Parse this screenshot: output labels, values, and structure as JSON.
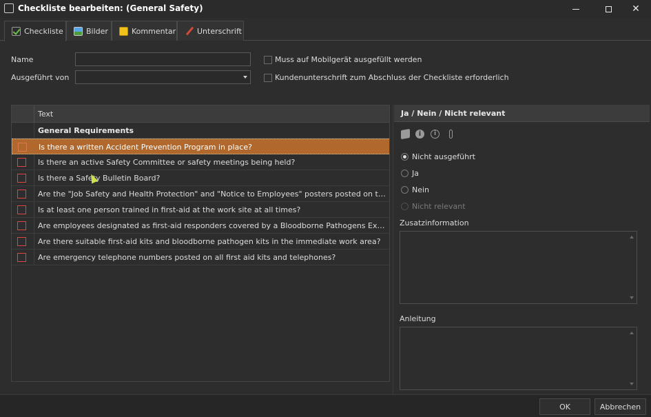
{
  "window": {
    "title": "Checkliste bearbeiten: (General Safety)"
  },
  "tabs": [
    {
      "label": "Checkliste",
      "icon": "checklist-icon"
    },
    {
      "label": "Bilder",
      "icon": "image-icon"
    },
    {
      "label": "Kommentar",
      "icon": "note-icon"
    },
    {
      "label": "Unterschrift",
      "icon": "pen-icon"
    }
  ],
  "form": {
    "name_label": "Name",
    "name_value": "",
    "executed_by_label": "Ausgeführt von",
    "executed_by_value": "",
    "mobile_required_label": "Muss auf Mobilgerät ausgefüllt werden",
    "customer_signature_label": "Kundenunterschrift zum Abschluss der Checkliste erforderlich"
  },
  "grid": {
    "header": "Text",
    "group": "General Requirements",
    "rows": [
      "Is there a written Accident Prevention Program in place?",
      "Is there an active Safety Committee or safety meetings being held?",
      "Is there a Safety Bulletin Board?",
      "Are the \"Job Safety and Health Protection\" and \"Notice to Employees\" posters posted on the Safety Bul...",
      "Is at least one person trained in first-aid at the work site at all times?",
      "Are employees designated as first-aid responders covered by a Bloodborne Pathogens Exposure Contr...",
      "Are there suitable first-aid kits and bloodborne pathogen kits in the immediate work area?",
      "Are emergency telephone numbers posted on all first aid kits and telephones?"
    ]
  },
  "right_panel": {
    "header": "Ja / Nein / Nicht relevant",
    "options": [
      "Nicht ausgeführt",
      "Ja",
      "Nein",
      "Nicht relevant"
    ],
    "selected_option": "Nicht ausgeführt",
    "extra_info_label": "Zusatzinformation",
    "instructions_label": "Anleitung"
  },
  "footer": {
    "ok_label": "OK",
    "cancel_label": "Abbrechen"
  },
  "colors": {
    "selection": "#b0682c",
    "checkbox_border": "#e0463a",
    "background": "#2d2d2d"
  }
}
